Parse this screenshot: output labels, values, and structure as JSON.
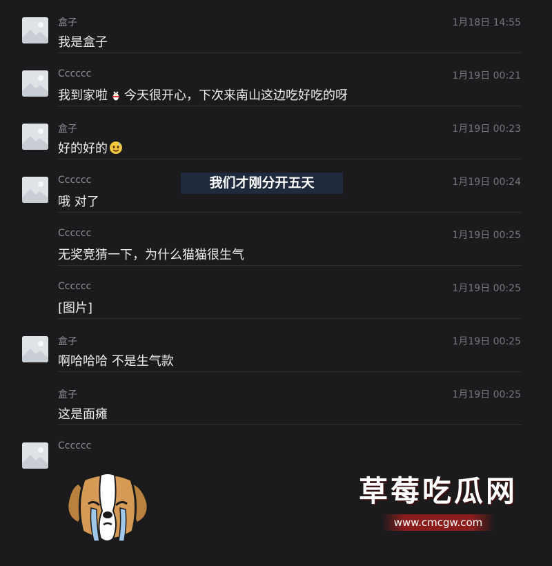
{
  "overlay_caption": "我们才刚分开五天",
  "messages": [
    {
      "sender": "盒子",
      "time": "1月18日 14:55",
      "text": "我是盒子",
      "avatar": true
    },
    {
      "sender": "Cccccc",
      "time": "1月19日 00:21",
      "text_before": "我到家啦",
      "emoji": "penguin-emoji",
      "text_after": "今天很开心，下次来南山这边吃好吃的呀",
      "avatar": true
    },
    {
      "sender": "盒子",
      "time": "1月19日 00:23",
      "text_before": "好的好的",
      "emoji": "sweat-smile-emoji",
      "avatar": true
    },
    {
      "sender": "Cccccc",
      "time": "1月19日 00:24",
      "text": "哦 对了",
      "avatar": true
    },
    {
      "sender": "Cccccc",
      "time": "1月19日 00:25",
      "text": "无奖竞猜一下，为什么猫猫很生气",
      "avatar": false
    },
    {
      "sender": "Cccccc",
      "time": "1月19日 00:25",
      "text": "[图片]",
      "avatar": false
    },
    {
      "sender": "盒子",
      "time": "1月19日 00:25",
      "text": "啊哈哈哈 不是生气款",
      "avatar": true
    },
    {
      "sender": "盒子",
      "time": "1月19日 00:25",
      "text": "这是面瘫",
      "avatar": false
    },
    {
      "sender": "Cccccc",
      "time": "",
      "text": "",
      "avatar": true
    }
  ],
  "watermark": {
    "title": "草莓吃瓜网",
    "url": "www.cmcgw.com"
  }
}
